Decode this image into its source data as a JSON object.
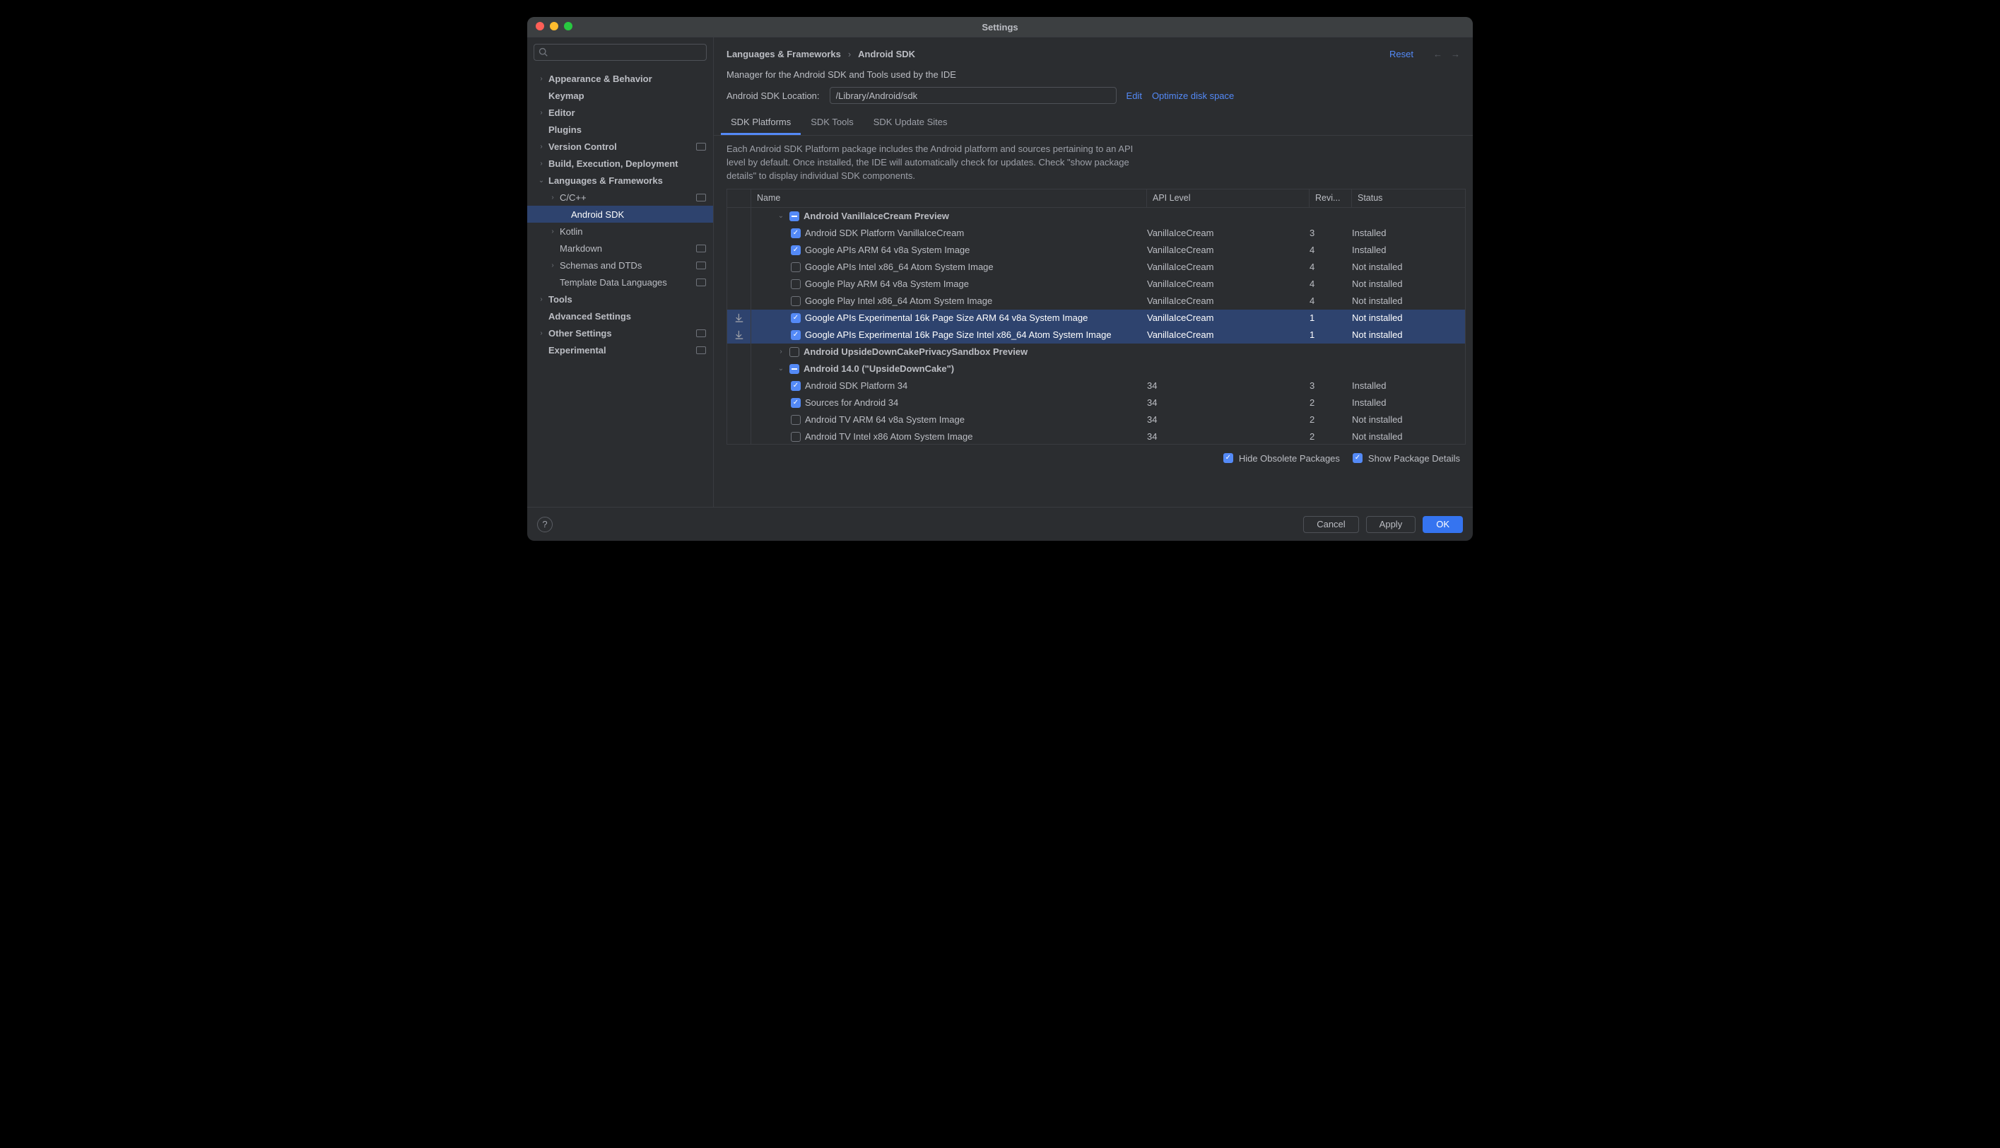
{
  "title": "Settings",
  "search_placeholder": "",
  "sidebar": [
    {
      "label": "Appearance & Behavior",
      "indent": 0,
      "chev": "›",
      "bold": true
    },
    {
      "label": "Keymap",
      "indent": 0,
      "chev": "",
      "bold": true
    },
    {
      "label": "Editor",
      "indent": 0,
      "chev": "›",
      "bold": true
    },
    {
      "label": "Plugins",
      "indent": 0,
      "chev": "",
      "bold": true
    },
    {
      "label": "Version Control",
      "indent": 0,
      "chev": "›",
      "badge": true,
      "bold": true
    },
    {
      "label": "Build, Execution, Deployment",
      "indent": 0,
      "chev": "›",
      "bold": true
    },
    {
      "label": "Languages & Frameworks",
      "indent": 0,
      "chev": "⌄",
      "bold": true
    },
    {
      "label": "C/C++",
      "indent": 1,
      "chev": "›",
      "badge": true
    },
    {
      "label": "Android SDK",
      "indent": 2,
      "chev": "",
      "sel": true
    },
    {
      "label": "Kotlin",
      "indent": 1,
      "chev": "›"
    },
    {
      "label": "Markdown",
      "indent": 1,
      "chev": "",
      "badge": true
    },
    {
      "label": "Schemas and DTDs",
      "indent": 1,
      "chev": "›",
      "badge": true
    },
    {
      "label": "Template Data Languages",
      "indent": 1,
      "chev": "",
      "badge": true
    },
    {
      "label": "Tools",
      "indent": 0,
      "chev": "›",
      "bold": true
    },
    {
      "label": "Advanced Settings",
      "indent": 0,
      "chev": "",
      "bold": true
    },
    {
      "label": "Other Settings",
      "indent": 0,
      "chev": "›",
      "badge": true,
      "bold": true
    },
    {
      "label": "Experimental",
      "indent": 0,
      "chev": "",
      "badge": true,
      "bold": true
    }
  ],
  "breadcrumb": {
    "a": "Languages & Frameworks",
    "b": "Android SDK"
  },
  "reset": "Reset",
  "manager_desc": "Manager for the Android SDK and Tools used by the IDE",
  "location_label": "Android SDK Location:",
  "location_value": "/Library/Android/sdk",
  "edit": "Edit",
  "optimize": "Optimize disk space",
  "tabs": [
    "SDK Platforms",
    "SDK Tools",
    "SDK Update Sites"
  ],
  "info": "Each Android SDK Platform package includes the Android platform and sources pertaining to an API level by default. Once installed, the IDE will automatically check for updates. Check \"show package details\" to display individual SDK components.",
  "columns": {
    "name": "Name",
    "api": "API Level",
    "rev": "Revi...",
    "status": "Status"
  },
  "rows": [
    {
      "type": "group",
      "name": "Android VanillaIceCream Preview",
      "chev": "⌄",
      "chk": "ind"
    },
    {
      "type": "item",
      "name": "Android SDK Platform VanillaIceCream",
      "api": "VanillaIceCream",
      "rev": "3",
      "st": "Installed",
      "chk": "chk"
    },
    {
      "type": "item",
      "name": "Google APIs ARM 64 v8a System Image",
      "api": "VanillaIceCream",
      "rev": "4",
      "st": "Installed",
      "chk": "chk"
    },
    {
      "type": "item",
      "name": "Google APIs Intel x86_64 Atom System Image",
      "api": "VanillaIceCream",
      "rev": "4",
      "st": "Not installed",
      "chk": ""
    },
    {
      "type": "item",
      "name": "Google Play ARM 64 v8a System Image",
      "api": "VanillaIceCream",
      "rev": "4",
      "st": "Not installed",
      "chk": ""
    },
    {
      "type": "item",
      "name": "Google Play Intel x86_64 Atom System Image",
      "api": "VanillaIceCream",
      "rev": "4",
      "st": "Not installed",
      "chk": ""
    },
    {
      "type": "item",
      "name": "Google APIs Experimental 16k Page Size ARM 64 v8a System Image",
      "api": "VanillaIceCream",
      "rev": "1",
      "st": "Not installed",
      "chk": "chk",
      "sel": true,
      "dl": true
    },
    {
      "type": "item",
      "name": "Google APIs Experimental 16k Page Size Intel x86_64 Atom System Image",
      "api": "VanillaIceCream",
      "rev": "1",
      "st": "Not installed",
      "chk": "chk",
      "sel": true,
      "dl": true
    },
    {
      "type": "group",
      "name": "Android UpsideDownCakePrivacySandbox Preview",
      "chev": "›",
      "chk": ""
    },
    {
      "type": "group",
      "name": "Android 14.0 (\"UpsideDownCake\")",
      "chev": "⌄",
      "chk": "ind"
    },
    {
      "type": "item",
      "name": "Android SDK Platform 34",
      "api": "34",
      "rev": "3",
      "st": "Installed",
      "chk": "chk"
    },
    {
      "type": "item",
      "name": "Sources for Android 34",
      "api": "34",
      "rev": "2",
      "st": "Installed",
      "chk": "chk"
    },
    {
      "type": "item",
      "name": "Android TV ARM 64 v8a System Image",
      "api": "34",
      "rev": "2",
      "st": "Not installed",
      "chk": ""
    },
    {
      "type": "item",
      "name": "Android TV Intel x86 Atom System Image",
      "api": "34",
      "rev": "2",
      "st": "Not installed",
      "chk": ""
    }
  ],
  "hide_obsolete": "Hide Obsolete Packages",
  "show_details": "Show Package Details",
  "buttons": {
    "cancel": "Cancel",
    "apply": "Apply",
    "ok": "OK"
  }
}
